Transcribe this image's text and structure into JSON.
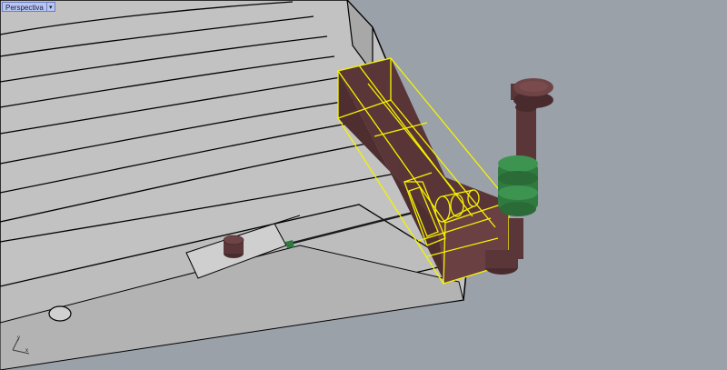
{
  "viewport": {
    "name": "Perspectiva",
    "menu_icon": "dropdown-arrow-icon"
  },
  "axes": {
    "x_label": "x",
    "y_label": "y"
  },
  "colors": {
    "background": "#9aa1a9",
    "surface": "#bfbfbf",
    "surface_dark": "#a9a9a9",
    "edge": "#000000",
    "selection": "#f4f400",
    "body_brown": "#5b3638",
    "body_brown_light": "#6f4446",
    "clamp_green": "#2f7a3f",
    "tab_bg": "#b9c7ee"
  }
}
